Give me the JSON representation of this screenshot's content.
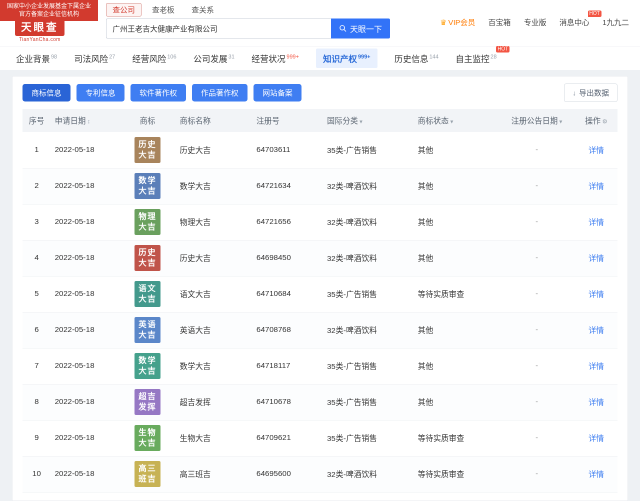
{
  "ribbon": {
    "line1": "国家中小企业发展基金下属企业",
    "line2": "官方备案企业征信机构"
  },
  "header": {
    "logo_name": "天眼查",
    "logo_domain": "TianYanCha.com",
    "search_tabs": [
      {
        "label": "查公司",
        "active": true
      },
      {
        "label": "查老板",
        "active": false
      },
      {
        "label": "查关系",
        "active": false
      }
    ],
    "search_value": "广州王老吉大健康产业有限公司",
    "search_button": "天眼一下",
    "user_menu": [
      {
        "label": "VIP会员",
        "icon": "crown"
      },
      {
        "label": "百宝箱"
      },
      {
        "label": "专业版"
      },
      {
        "label": "消息中心",
        "badge": "HOT"
      },
      {
        "label": "1九九二"
      }
    ]
  },
  "nav": {
    "items": [
      {
        "label": "企业背景",
        "count": "98"
      },
      {
        "label": "司法风险",
        "count": "27"
      },
      {
        "label": "经营风险",
        "count": "106"
      },
      {
        "label": "公司发展",
        "count": "31"
      },
      {
        "label": "经营状况",
        "count": "999+",
        "hot": true
      },
      {
        "label": "知识产权",
        "count": "999+",
        "active": true,
        "hot": true
      },
      {
        "label": "历史信息",
        "count": "144"
      },
      {
        "label": "自主监控",
        "count": "28",
        "badge": "HOT"
      }
    ]
  },
  "toolbar": {
    "tabs": [
      {
        "label": "商标信息",
        "active": true
      },
      {
        "label": "专利信息",
        "active": false
      },
      {
        "label": "软件著作权",
        "active": false
      },
      {
        "label": "作品著作权",
        "active": false
      },
      {
        "label": "网站备案",
        "active": false
      }
    ],
    "export_label": "导出数据"
  },
  "table": {
    "columns": [
      {
        "label": "序号",
        "align": "center"
      },
      {
        "label": "申请日期",
        "icon": "sort"
      },
      {
        "label": "商标",
        "align": "center"
      },
      {
        "label": "商标名称"
      },
      {
        "label": "注册号"
      },
      {
        "label": "国际分类",
        "icon": "filter"
      },
      {
        "label": "商标状态",
        "icon": "filter"
      },
      {
        "label": "注册公告日期",
        "align": "center",
        "icon": "filter"
      },
      {
        "label": "操作",
        "align": "center",
        "icon": "gear"
      }
    ],
    "action_label": "详情",
    "rows": [
      {
        "no": "1",
        "date": "2022-05-18",
        "mark": "历史大吉",
        "mark_color": "#a8845c",
        "name": "历史大吉",
        "reg_no": "64703611",
        "intl_class": "35类-广告销售",
        "status": "其他",
        "announce": "-"
      },
      {
        "no": "2",
        "date": "2022-05-18",
        "mark": "数学大吉",
        "mark_color": "#5b7fb9",
        "name": "数学大吉",
        "reg_no": "64721634",
        "intl_class": "32类-啤酒饮料",
        "status": "其他",
        "announce": "-"
      },
      {
        "no": "3",
        "date": "2022-05-18",
        "mark": "物理大吉",
        "mark_color": "#6aa05e",
        "name": "物理大吉",
        "reg_no": "64721656",
        "intl_class": "32类-啤酒饮料",
        "status": "其他",
        "announce": "-"
      },
      {
        "no": "4",
        "date": "2022-05-18",
        "mark": "历史大吉",
        "mark_color": "#c0544a",
        "name": "历史大吉",
        "reg_no": "64698450",
        "intl_class": "32类-啤酒饮料",
        "status": "其他",
        "announce": "-"
      },
      {
        "no": "5",
        "date": "2022-05-18",
        "mark": "语文大吉",
        "mark_color": "#43998c",
        "name": "语文大吉",
        "reg_no": "64710684",
        "intl_class": "35类-广告销售",
        "status": "等待实质审查",
        "announce": "-"
      },
      {
        "no": "6",
        "date": "2022-05-18",
        "mark": "英语大吉",
        "mark_color": "#5b87c9",
        "name": "英语大吉",
        "reg_no": "64708768",
        "intl_class": "32类-啤酒饮料",
        "status": "其他",
        "announce": "-"
      },
      {
        "no": "7",
        "date": "2022-05-18",
        "mark": "数学大吉",
        "mark_color": "#45a18c",
        "name": "数学大吉",
        "reg_no": "64718117",
        "intl_class": "35类-广告销售",
        "status": "其他",
        "announce": "-"
      },
      {
        "no": "8",
        "date": "2022-05-18",
        "mark": "超吉发挥",
        "mark_color": "#9678c4",
        "name": "超吉发挥",
        "reg_no": "64710678",
        "intl_class": "35类-广告销售",
        "status": "其他",
        "announce": "-"
      },
      {
        "no": "9",
        "date": "2022-05-18",
        "mark": "生物大吉",
        "mark_color": "#69ab5e",
        "name": "生物大吉",
        "reg_no": "64709621",
        "intl_class": "35类-广告销售",
        "status": "等待实质审查",
        "announce": "-"
      },
      {
        "no": "10",
        "date": "2022-05-18",
        "mark": "高三班吉",
        "mark_color": "#c7b254",
        "name": "高三班吉",
        "reg_no": "64695600",
        "intl_class": "32类-啤酒饮料",
        "status": "等待实质审查",
        "announce": "-"
      }
    ]
  }
}
